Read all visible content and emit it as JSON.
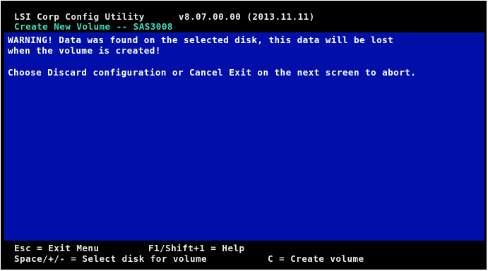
{
  "header": {
    "title": "LSI Corp Config Utility      v8.07.00.00 (2013.11.11)",
    "subtitle": "Create New Volume -- SAS3008"
  },
  "body": {
    "warning_line1": "WARNING! Data was found on the selected disk, this data will be lost",
    "warning_line2": "when the volume is created!",
    "instruction": "Choose Discard configuration or Cancel Exit on the next screen to abort."
  },
  "footer": {
    "esc_hint": "Esc = Exit Menu",
    "help_hint": "F1/Shift+1 = Help",
    "select_hint": "Space/+/- = Select disk for volume",
    "create_hint": "C = Create volume"
  },
  "colors": {
    "background_blue": "#000fa8",
    "frame_black": "#000000",
    "subtitle_cyan": "#3fe0c4",
    "text_white": "#ffffff"
  }
}
